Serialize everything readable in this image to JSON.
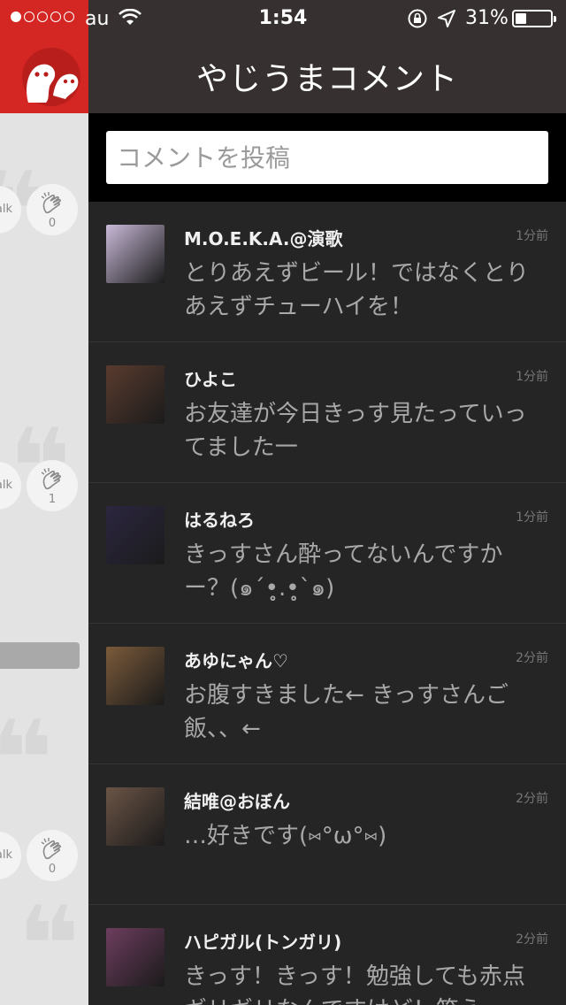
{
  "status_bar": {
    "carrier": "au",
    "time": "1:54",
    "battery": "31%",
    "battery_level": 0.31,
    "signal_bars": 1,
    "icons": [
      "wifi-icon",
      "orientation-lock-icon",
      "location-arrow-icon",
      "battery-icon"
    ]
  },
  "header": {
    "title": "やじうまコメント"
  },
  "compose": {
    "placeholder": "コメントを投稿"
  },
  "left_panel": {
    "talk_label": "alk",
    "clap_counts": [
      "0",
      "1",
      "0"
    ]
  },
  "comments": [
    {
      "user": "M.O.E.K.A.@演歌",
      "time": "1分前",
      "text": "とりあえずビール！ではなくとりあえずチューハイを！",
      "avatar_color": "#c9b9d8"
    },
    {
      "user": "ひよこ",
      "time": "1分前",
      "text": "お友達が今日きっす見たっていってました一",
      "avatar_color": "#5a3b2e"
    },
    {
      "user": "はるねろ",
      "time": "1分前",
      "text": "きっすさん酔ってないんですかー？(๑´•̥̥̥.•̥̥̥`๑)",
      "avatar_color": "#2c2640"
    },
    {
      "user": "あゆにゃん♡",
      "time": "2分前",
      "text": "お腹すきました← きっすさんご飯、、←",
      "avatar_color": "#7b5a3a"
    },
    {
      "user": "結唯@おぼん",
      "time": "2分前",
      "text": "…好きです(⑅°ω°⑅)",
      "avatar_color": "#6b5446"
    },
    {
      "user": "ハピガル(トンガリ)",
      "time": "2分前",
      "text": "きっす！きっす！勉強しても赤点ギリギリなんですけど！笑え",
      "avatar_color": "#6d3d5e"
    }
  ],
  "colors": {
    "accent_red": "#d42623",
    "header_bg": "#363130",
    "list_bg": "#252525"
  }
}
